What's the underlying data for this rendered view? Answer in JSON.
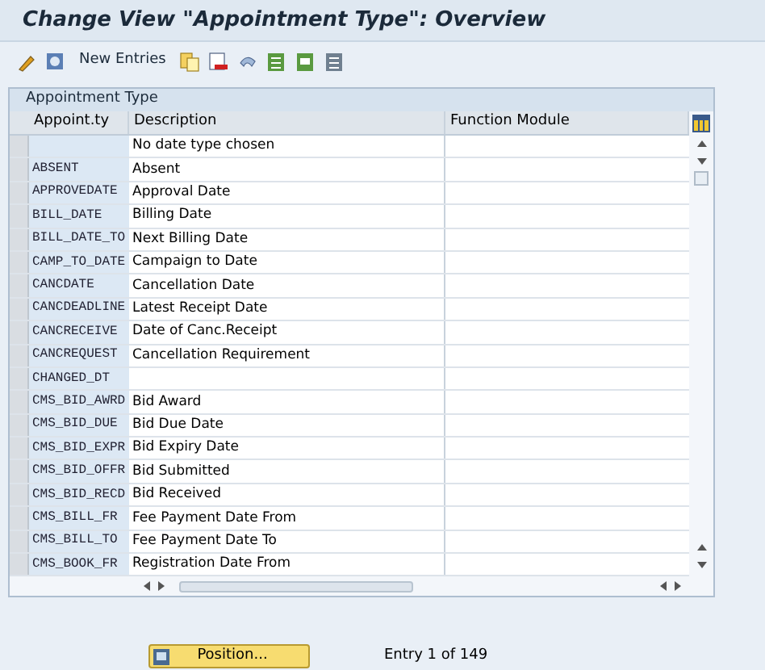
{
  "window": {
    "title": "Change View \"Appointment Type\": Overview"
  },
  "toolbar": {
    "new_entries": "New Entries"
  },
  "table": {
    "title": "Appointment Type",
    "columns": [
      "Appoint.ty",
      "Description",
      "Function Module"
    ],
    "rows": [
      {
        "key": "",
        "description": "No date type chosen"
      },
      {
        "key": "ABSENT",
        "description": "Absent"
      },
      {
        "key": "APPROVEDATE",
        "description": "Approval Date"
      },
      {
        "key": "BILL_DATE",
        "description": "Billing Date"
      },
      {
        "key": "BILL_DATE_TO",
        "description": "Next Billing Date"
      },
      {
        "key": "CAMP_TO_DATE",
        "description": "Campaign to Date"
      },
      {
        "key": "CANCDATE",
        "description": "Cancellation Date"
      },
      {
        "key": "CANCDEADLINE",
        "description": "Latest Receipt Date"
      },
      {
        "key": "CANCRECEIVE",
        "description": "Date of Canc.Receipt"
      },
      {
        "key": "CANCREQUEST",
        "description": "Cancellation Requirement"
      },
      {
        "key": "CHANGED_DT",
        "description": ""
      },
      {
        "key": "CMS_BID_AWRD",
        "description": "Bid Award"
      },
      {
        "key": "CMS_BID_DUE",
        "description": "Bid Due Date"
      },
      {
        "key": "CMS_BID_EXPR",
        "description": "Bid Expiry Date"
      },
      {
        "key": "CMS_BID_OFFR",
        "description": "Bid Submitted"
      },
      {
        "key": "CMS_BID_RECD",
        "description": "Bid Received"
      },
      {
        "key": "CMS_BILL_FR",
        "description": "Fee Payment Date From"
      },
      {
        "key": "CMS_BILL_TO",
        "description": "Fee Payment Date To"
      },
      {
        "key": "CMS_BOOK_FR",
        "description": "Registration Date From"
      }
    ]
  },
  "footer": {
    "position_button": "Position...",
    "entry_info": "Entry 1 of 149"
  }
}
